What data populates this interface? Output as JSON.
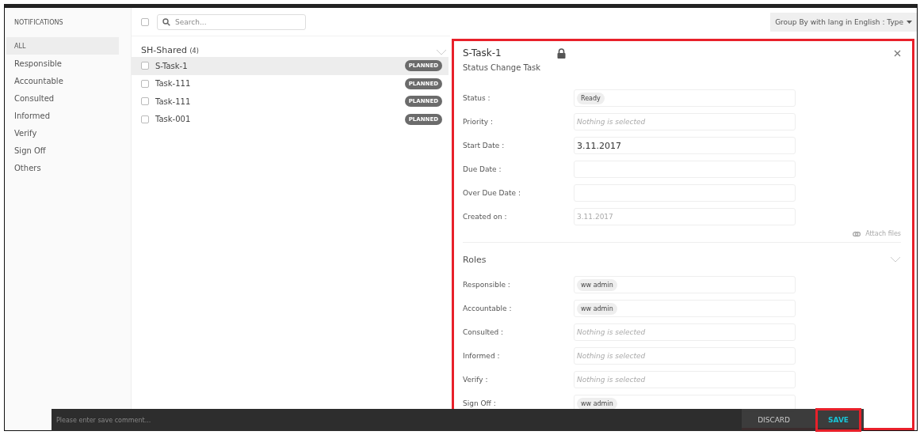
{
  "sidebar": {
    "title": "NOTIFICATIONS",
    "items": [
      {
        "label": "ALL",
        "selected": true
      },
      {
        "label": "Responsible",
        "selected": false
      },
      {
        "label": "Accountable",
        "selected": false
      },
      {
        "label": "Consulted",
        "selected": false
      },
      {
        "label": "Informed",
        "selected": false
      },
      {
        "label": "Verify",
        "selected": false
      },
      {
        "label": "Sign Off",
        "selected": false
      },
      {
        "label": "Others",
        "selected": false
      }
    ]
  },
  "toolbar": {
    "select_all": {
      "checked": false
    },
    "search": {
      "placeholder": "Search..."
    },
    "group_by": "Group By with lang in English : Type"
  },
  "group": {
    "title": "SH-Shared",
    "count": "(4)",
    "expanded": true,
    "tasks": [
      {
        "name": "S-Task-1",
        "status": "PLANNED",
        "selected": true,
        "checked": false
      },
      {
        "name": "Task-111",
        "status": "PLANNED",
        "selected": false,
        "checked": false
      },
      {
        "name": "Task-111",
        "status": "PLANNED",
        "selected": false,
        "checked": false
      },
      {
        "name": "Task-001",
        "status": "PLANNED",
        "selected": false,
        "checked": false
      }
    ]
  },
  "detail": {
    "title": "S-Task-1",
    "locked": true,
    "subtitle": "Status Change Task",
    "fields": [
      {
        "label": "Status :",
        "kind": "chip",
        "value": "Ready"
      },
      {
        "label": "Priority :",
        "kind": "placeholder",
        "placeholder": "Nothing is selected"
      },
      {
        "label": "Start Date :",
        "kind": "text",
        "value": "3.11.2017"
      },
      {
        "label": "Due Date :",
        "kind": "text"
      },
      {
        "label": "Over Due Date :",
        "kind": "text"
      },
      {
        "label": "Created on :",
        "kind": "readonly",
        "value": "3.11.2017"
      }
    ],
    "attach": "Attach files",
    "roles_title": "Roles",
    "roles_expanded": true,
    "roles": [
      {
        "label": "Responsible :",
        "kind": "chip",
        "value": "ww admin"
      },
      {
        "label": "Accountable :",
        "kind": "chip",
        "value": "ww admin"
      },
      {
        "label": "Consulted :",
        "kind": "placeholder",
        "placeholder": "Nothing is selected"
      },
      {
        "label": "Informed :",
        "kind": "placeholder",
        "placeholder": "Nothing is selected"
      },
      {
        "label": "Verify :",
        "kind": "placeholder",
        "placeholder": "Nothing is selected"
      },
      {
        "label": "Sign Off :",
        "kind": "chip",
        "value": "ww admin"
      }
    ]
  },
  "save_bar": {
    "placeholder": "Please enter save comment...",
    "buttons": [
      "DISCARD",
      "SAVE"
    ]
  }
}
